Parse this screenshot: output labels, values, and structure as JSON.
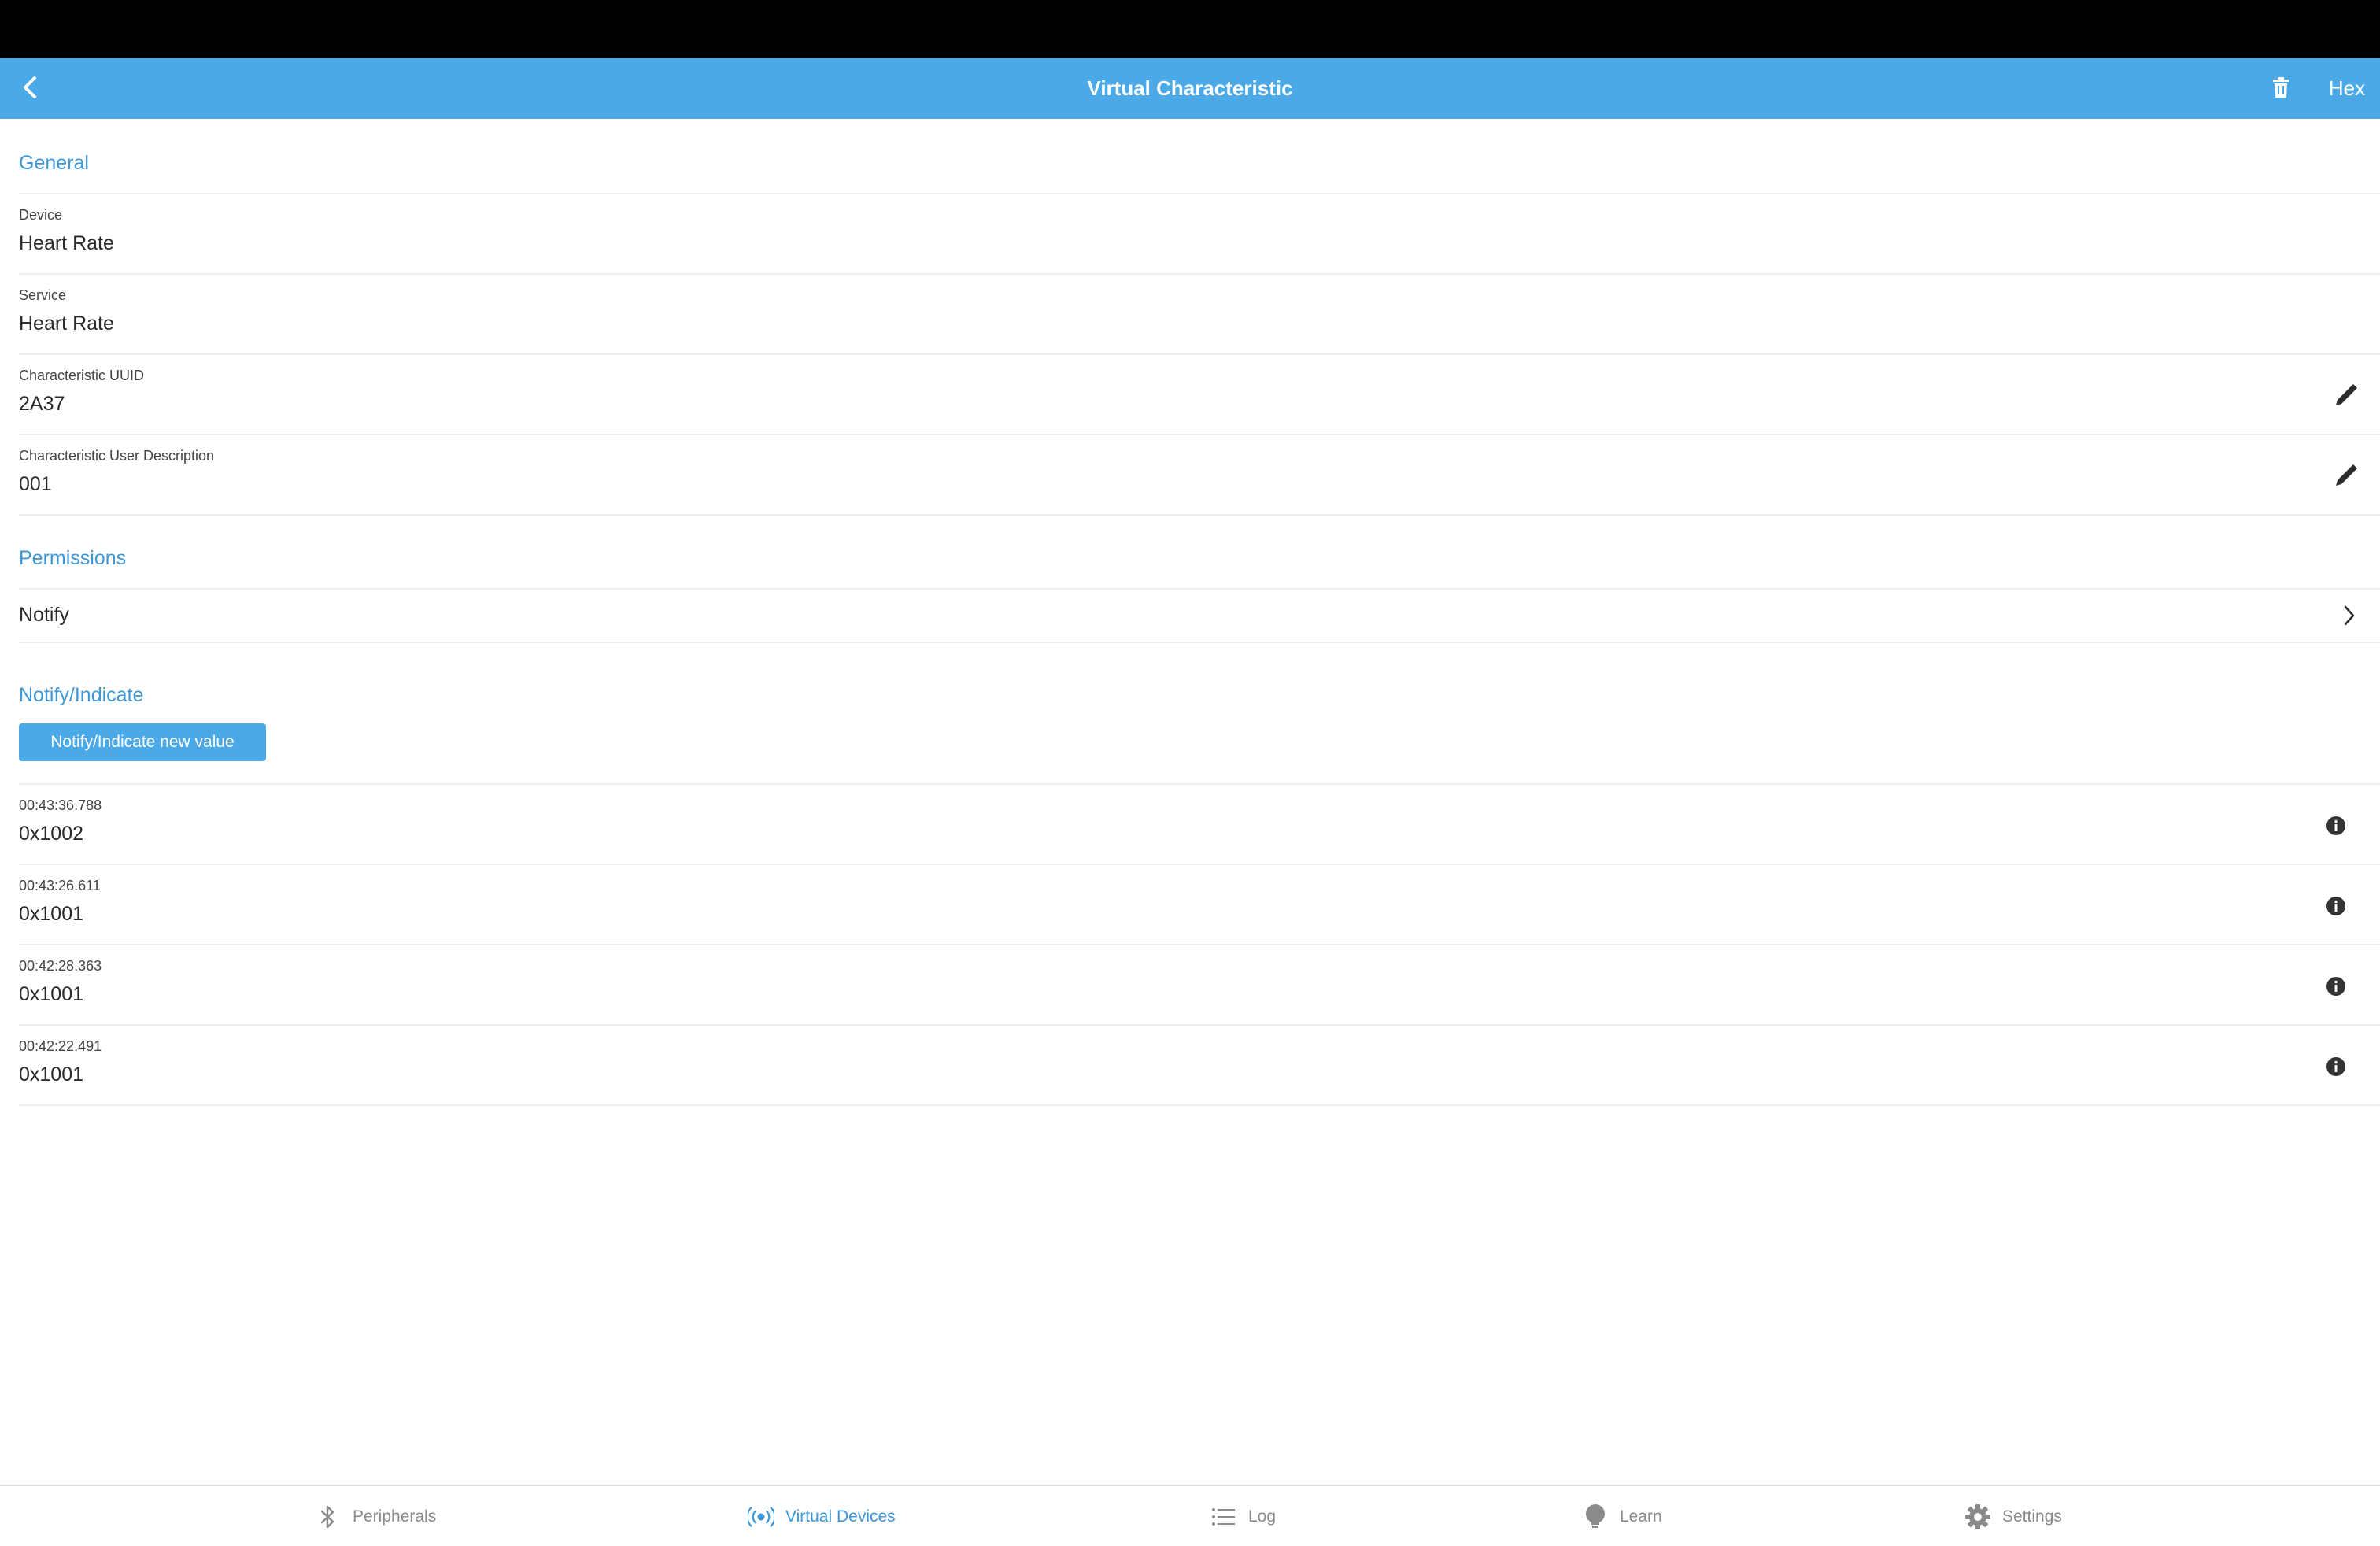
{
  "colors": {
    "accent": "#4ba9e7",
    "section_header": "#3d97d9",
    "status_bar": "#000000",
    "tab_inactive": "#8a8a8a",
    "tab_active": "#3d97d9"
  },
  "header": {
    "back_icon": "chevron-left-icon",
    "title": "Virtual Characteristic",
    "trash_icon": "trash-icon",
    "format_label": "Hex"
  },
  "general": {
    "header": "General",
    "fields": [
      {
        "label": "Device",
        "value": "Heart Rate"
      },
      {
        "label": "Service",
        "value": "Heart Rate"
      },
      {
        "label": "Characteristic UUID",
        "value": "2A37",
        "editable": true
      },
      {
        "label": "Characteristic User Description",
        "value": "001",
        "editable": true
      }
    ]
  },
  "permissions": {
    "header": "Permissions",
    "item": "Notify"
  },
  "notify": {
    "header": "Notify/Indicate",
    "button_label": "Notify/Indicate new value",
    "entries": [
      {
        "time": "00:43:36.788",
        "value": "0x1002"
      },
      {
        "time": "00:43:26.611",
        "value": "0x1001"
      },
      {
        "time": "00:42:28.363",
        "value": "0x1001"
      },
      {
        "time": "00:42:22.491",
        "value": "0x1001"
      }
    ]
  },
  "tabs": [
    {
      "label": "Peripherals",
      "icon": "bluetooth-icon",
      "active": false
    },
    {
      "label": "Virtual Devices",
      "icon": "broadcast-icon",
      "active": true
    },
    {
      "label": "Log",
      "icon": "list-icon",
      "active": false
    },
    {
      "label": "Learn",
      "icon": "lightbulb-icon",
      "active": false
    },
    {
      "label": "Settings",
      "icon": "gear-icon",
      "active": false
    }
  ]
}
